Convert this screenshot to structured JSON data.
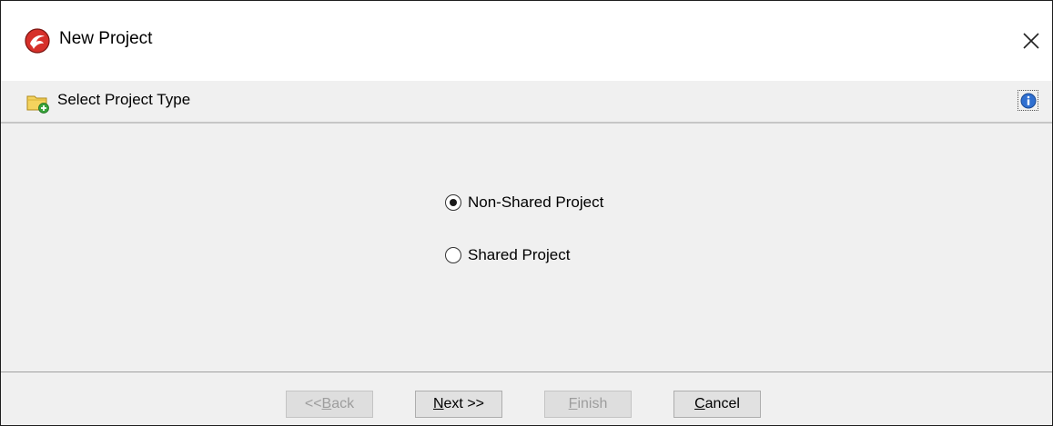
{
  "window": {
    "title": "New Project",
    "close_glyph": "✕",
    "icon": "red-swirl-app-icon"
  },
  "wizard": {
    "step_title": "Select Project Type",
    "step_icon": "folder-add-icon",
    "info_icon": "info-icon"
  },
  "options": [
    {
      "label": "Non-Shared Project",
      "selected": true
    },
    {
      "label": "Shared Project",
      "selected": false
    }
  ],
  "buttons": {
    "back": {
      "pre": "<< ",
      "mnemonic": "B",
      "post": "ack",
      "enabled": false
    },
    "next": {
      "pre": "",
      "mnemonic": "N",
      "post": "ext >>",
      "enabled": true
    },
    "finish": {
      "pre": "",
      "mnemonic": "F",
      "post": "inish",
      "enabled": false
    },
    "cancel": {
      "pre": "",
      "mnemonic": "C",
      "post": "ancel",
      "enabled": true
    }
  },
  "colors": {
    "dialog_bg": "#f0f0f0",
    "titlebar_bg": "#ffffff",
    "icon_red": "#d6302a",
    "info_blue": "#2f6fd0"
  }
}
